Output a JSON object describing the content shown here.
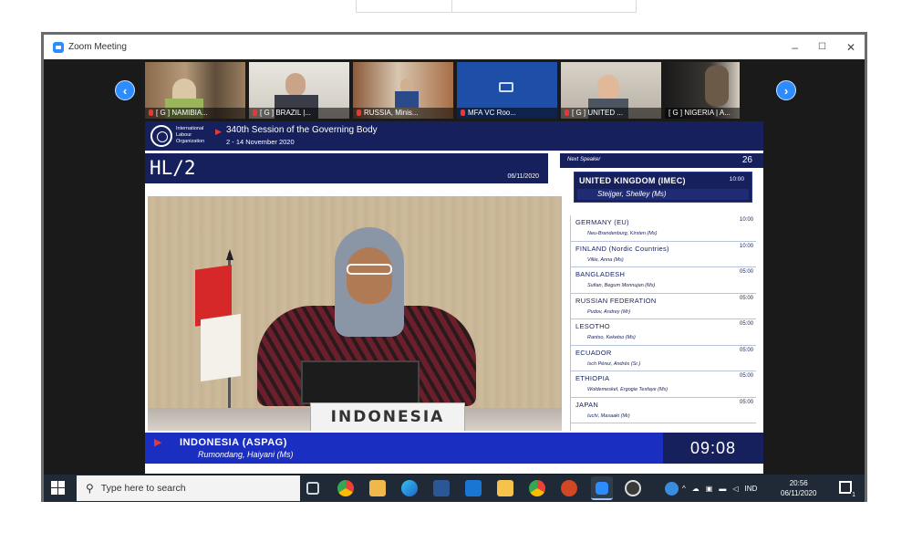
{
  "window": {
    "title": "Zoom Meeting",
    "controls": {
      "minimize": "–",
      "maximize": "☐",
      "close": "✕"
    }
  },
  "participants": [
    {
      "label": "[ G ] NAMIBIA..."
    },
    {
      "label": "[ G ] BRAZIL |..."
    },
    {
      "label": "RUSSIA, Minis..."
    },
    {
      "label": "MFA VC Roo..."
    },
    {
      "label": "[ G ] UNITED ..."
    },
    {
      "label": "[ G ] NIGERIA | A..."
    }
  ],
  "broadcast": {
    "org_name": "International\nLabour\nOrganization",
    "session_title": "340th Session of the Governing Body",
    "session_dates": "2 - 14 November 2020",
    "room_code": "HL/2",
    "room_date": "06/11/2020",
    "next_label": "Next Speaker",
    "next_count": "26",
    "next_speaker": {
      "country": "UNITED KINGDOM (IMEC)",
      "time": "10:00",
      "name": "Steijger, Shelley (Ms)"
    },
    "speakers": [
      {
        "country": "GERMANY (EU)",
        "time": "10:00",
        "name": "Neu-Brandenburg, Kirsten (Ms)"
      },
      {
        "country": "FINLAND (Nordic Countries)",
        "time": "10:00",
        "name": "Villie, Anna (Ms)"
      },
      {
        "country": "BANGLADESH",
        "time": "05:00",
        "name": "Sufian, Begum Monnujan (Ms)"
      },
      {
        "country": "RUSSIAN FEDERATION",
        "time": "05:00",
        "name": "Pudov, Andrey (Mr)"
      },
      {
        "country": "LESOTHO",
        "time": "05:00",
        "name": "Rantso, Keketso (Ms)"
      },
      {
        "country": "ECUADOR",
        "time": "05:00",
        "name": "Isch Pérez, Andrés (Sr.)"
      },
      {
        "country": "ETHIOPIA",
        "time": "05:00",
        "name": "Woldemeskel, Ergogie Tesfaye (Ms)"
      },
      {
        "country": "JAPAN",
        "time": "05:00",
        "name": "Iuchi, Masaaki (Mr)"
      }
    ],
    "nameplate": "INDONESIA",
    "current_speaker": {
      "country": "INDONESIA (ASPAG)",
      "name": "Rumondang, Haiyani (Ms)",
      "clock": "09:08"
    }
  },
  "taskbar": {
    "search_placeholder": "Type here to search",
    "language": "IND",
    "time": "20:56",
    "date": "06/11/2020",
    "notification_count": "1"
  },
  "colors": {
    "ilo_navy": "#16205c",
    "speaker_blue": "#1a2fc2",
    "zoom_blue": "#2d8cff",
    "accent_red": "#e53935"
  }
}
